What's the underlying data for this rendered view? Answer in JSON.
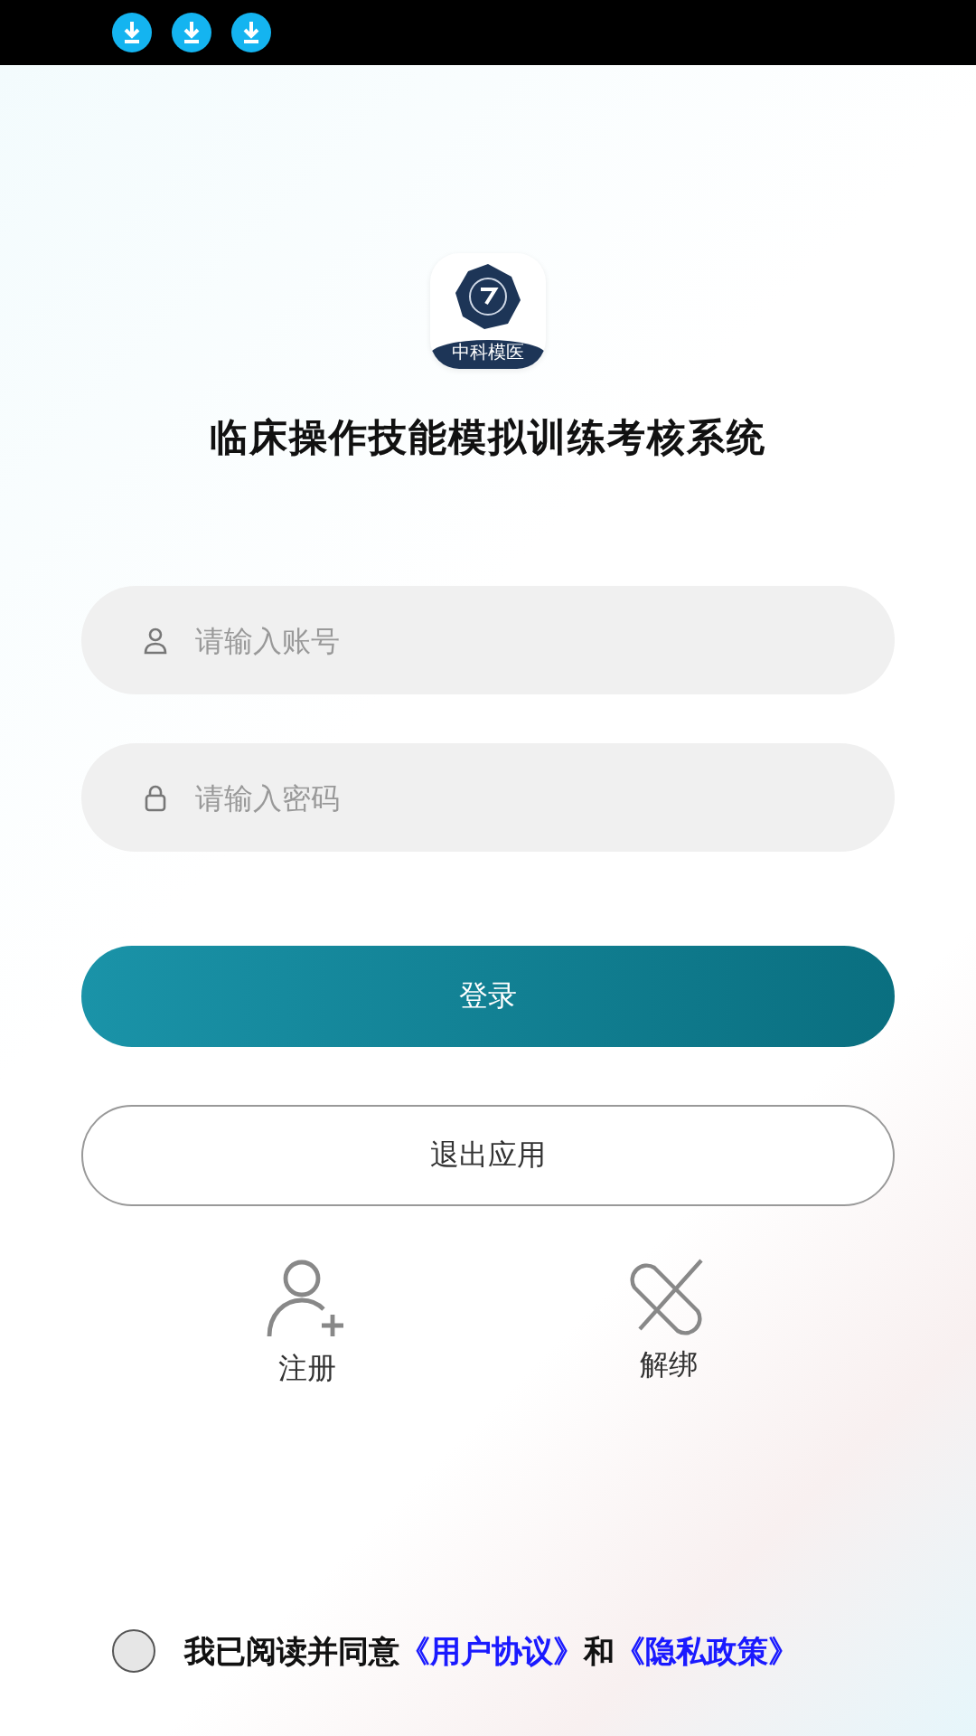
{
  "status_bar": {
    "notifications": [
      {
        "kind": "download"
      },
      {
        "kind": "download"
      },
      {
        "kind": "download"
      }
    ]
  },
  "logo": {
    "caption": "中科模医"
  },
  "title": "临床操作技能模拟训练考核系统",
  "fields": [
    {
      "kind": "user",
      "placeholder": "请输入账号"
    },
    {
      "kind": "lock",
      "placeholder": "请输入密码"
    }
  ],
  "login_button": "登录",
  "exit_button": "退出应用",
  "actions": [
    {
      "kind": "register",
      "label": "注册"
    },
    {
      "kind": "unbind",
      "label": "解绑"
    }
  ],
  "agreement": {
    "checked": false,
    "text": "我已阅读并同意",
    "link_1": "《用户协议》",
    "joiner": "和",
    "link_2": "《隐私政策》"
  }
}
